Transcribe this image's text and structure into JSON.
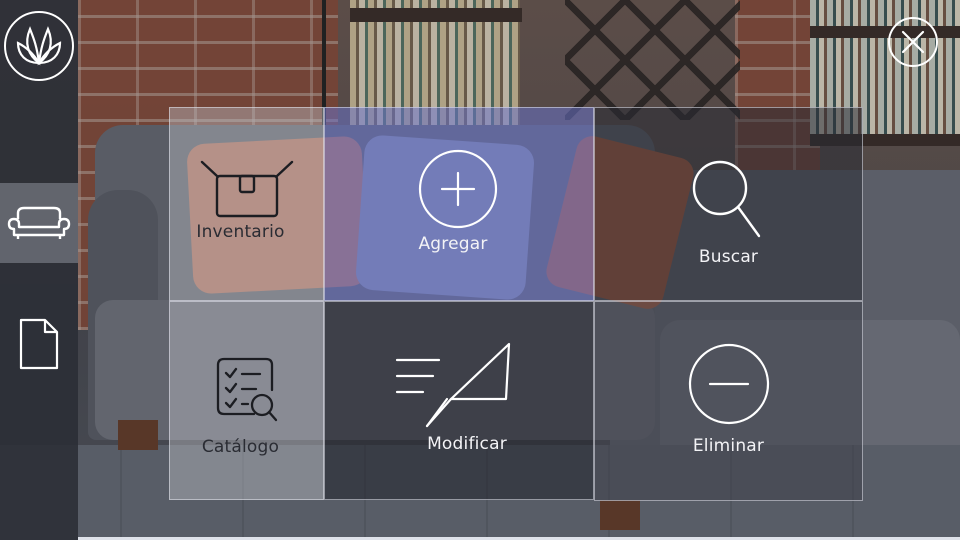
{
  "sidebar": {
    "logo_icon": "lotus-logo-icon",
    "items": [
      {
        "icon": "sofa-icon",
        "active": true
      },
      {
        "icon": "document-icon",
        "active": false
      }
    ]
  },
  "header": {
    "close_icon": "close-icon"
  },
  "tiles": [
    {
      "label": "Inventario",
      "icon": "box-icon"
    },
    {
      "label": "Agregar",
      "icon": "plus-circle-icon"
    },
    {
      "label": "Buscar",
      "icon": "search-icon"
    },
    {
      "label": "Catálogo",
      "icon": "checklist-search-icon"
    },
    {
      "label": "Modificar",
      "icon": "pencil-speed-icon"
    },
    {
      "label": "Eliminar",
      "icon": "minus-circle-icon"
    }
  ],
  "colors": {
    "accent_blue": "#6973c8",
    "sidebar": "#2a2e36",
    "text": "#f3f3f6"
  }
}
